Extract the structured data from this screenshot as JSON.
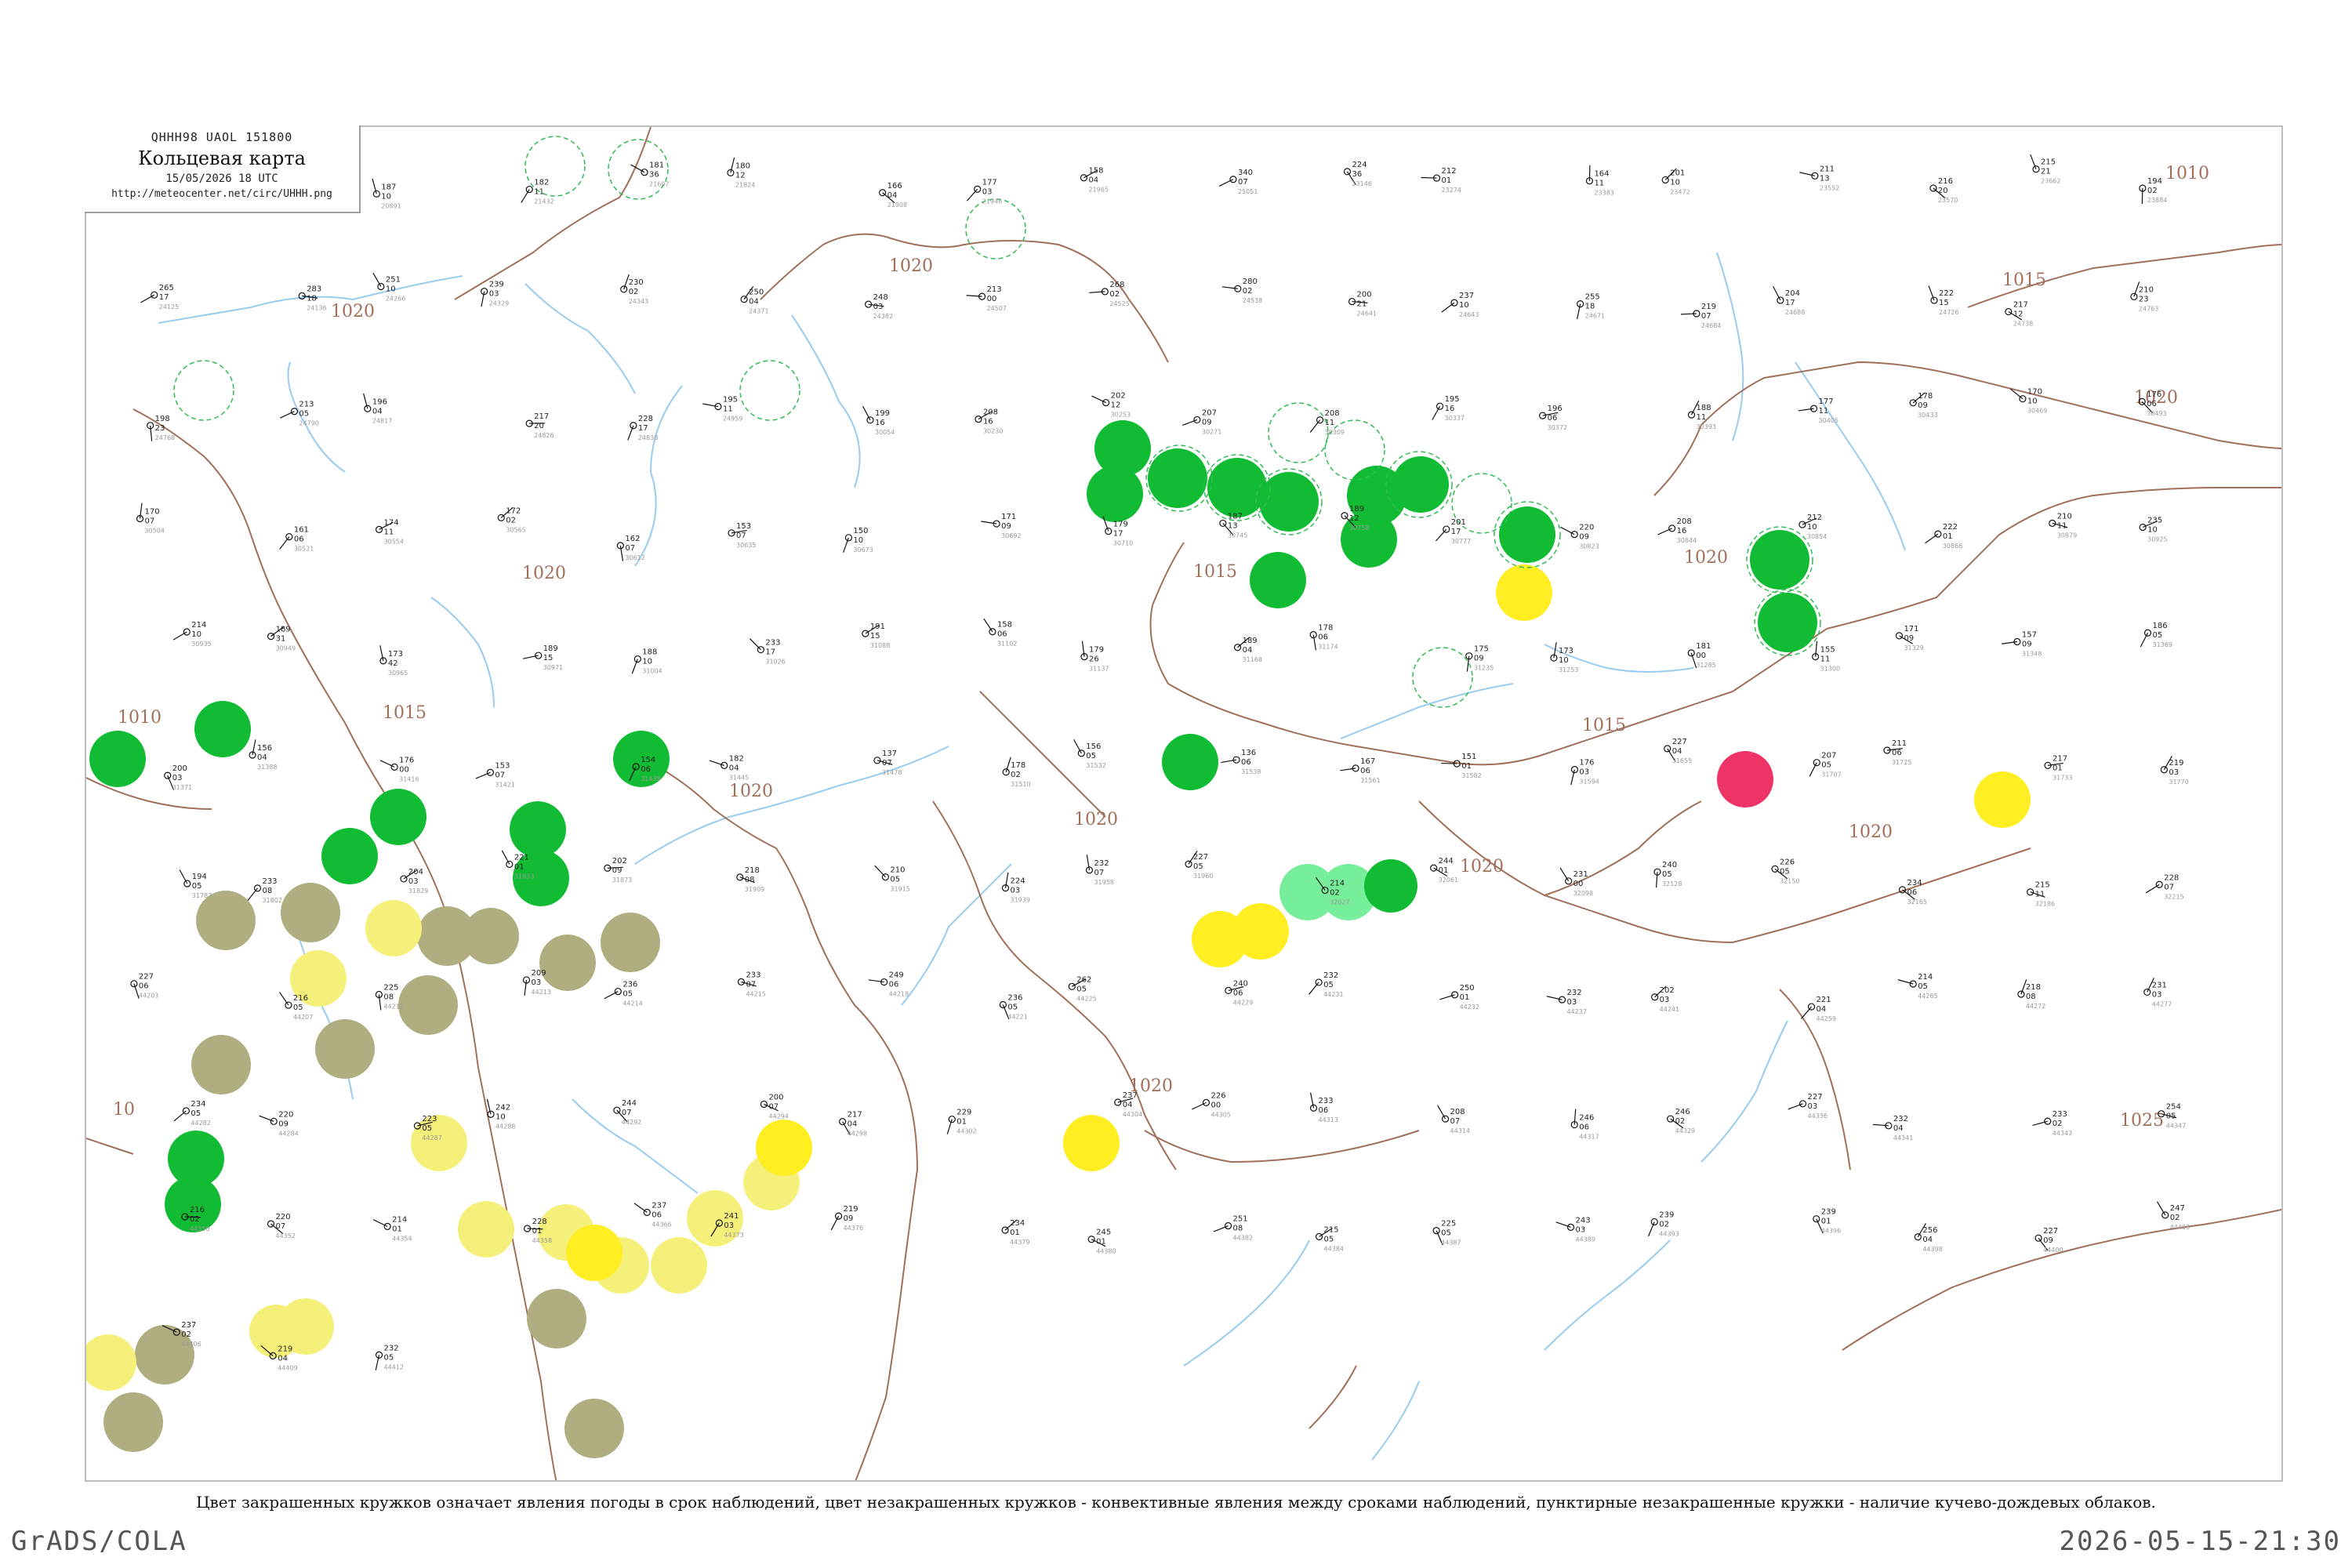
{
  "header": {
    "code": "QHHH98  UAOL  151800",
    "title": "Кольцевая карта",
    "datetime": "15/05/2026 18 UTC",
    "url": "http://meteocenter.net/circ/UHHH.png"
  },
  "caption": "Цвет закрашенных кружков означает явления погоды в срок наблюдений, цвет незакрашенных кружков - конвективные явления между сроками наблюдений, пунктирные незакрашенные кружки - наличие кучево-дождевых облаков.",
  "footer": {
    "left": "GrADS/COLA",
    "right": "2026-05-15-21:30"
  },
  "colors": {
    "rain": "#11bb33",
    "drizzle": "#77ee99",
    "haze": "#b0ad80",
    "dust": "#f5f07a",
    "fog": "#ffee22",
    "thunder": "#ee3366",
    "isobar": "#a0705a",
    "river": "#99ccee"
  },
  "isobar_labels": [
    "1010",
    "1015",
    "1020",
    "1020",
    "1020",
    "1020",
    "1015",
    "1015",
    "1020",
    "1020",
    "1015",
    "1020",
    "1020",
    "1025",
    "1010",
    "10",
    "1020",
    "1020"
  ],
  "stations": [
    {
      "t": "175",
      "p": "11",
      "id": "20744"
    },
    {
      "t": "149",
      "p": "03",
      "id": "20667"
    },
    {
      "t": "187",
      "p": "10",
      "id": "20891"
    },
    {
      "t": "182",
      "p": "11",
      "id": "21432"
    },
    {
      "t": "181",
      "p": "36",
      "id": "21607"
    },
    {
      "t": "180",
      "p": "12",
      "id": "21824"
    },
    {
      "t": "166",
      "p": "04",
      "id": "21908"
    },
    {
      "t": "177",
      "p": "03",
      "id": "21946"
    },
    {
      "t": "158",
      "p": "04",
      "id": "21965"
    },
    {
      "t": "340",
      "p": "07",
      "id": "25051"
    },
    {
      "t": "224",
      "p": "36",
      "id": "23146"
    },
    {
      "t": "212",
      "p": "01",
      "id": "23274"
    },
    {
      "t": "164",
      "p": "11",
      "id": "23383"
    },
    {
      "t": "201",
      "p": "10",
      "id": "23472"
    },
    {
      "t": "211",
      "p": "13",
      "id": "23552"
    },
    {
      "t": "216",
      "p": "20",
      "id": "23570"
    },
    {
      "t": "215",
      "p": "21",
      "id": "23662"
    },
    {
      "t": "194",
      "p": "02",
      "id": "23884"
    },
    {
      "t": "265",
      "p": "17",
      "id": "24125"
    },
    {
      "t": "283",
      "p": "18",
      "id": "24136"
    },
    {
      "t": "251",
      "p": "10",
      "id": "24266"
    },
    {
      "t": "239",
      "p": "03",
      "id": "24329"
    },
    {
      "t": "230",
      "p": "02",
      "id": "24343"
    },
    {
      "t": "250",
      "p": "04",
      "id": "24371"
    },
    {
      "t": "248",
      "p": "03",
      "id": "24382"
    },
    {
      "t": "213",
      "p": "00",
      "id": "24507"
    },
    {
      "t": "268",
      "p": "02",
      "id": "24525"
    },
    {
      "t": "280",
      "p": "02",
      "id": "24538"
    },
    {
      "t": "200",
      "p": "21",
      "id": "24641"
    },
    {
      "t": "237",
      "p": "10",
      "id": "24643"
    },
    {
      "t": "255",
      "p": "18",
      "id": "24671"
    },
    {
      "t": "219",
      "p": "07",
      "id": "24684"
    },
    {
      "t": "204",
      "p": "17",
      "id": "24688"
    },
    {
      "t": "222",
      "p": "15",
      "id": "24726"
    },
    {
      "t": "217",
      "p": "12",
      "id": "24738"
    },
    {
      "t": "210",
      "p": "23",
      "id": "24763"
    },
    {
      "t": "198",
      "p": "23",
      "id": "24768"
    },
    {
      "t": "213",
      "p": "05",
      "id": "24790"
    },
    {
      "t": "196",
      "p": "04",
      "id": "24817"
    },
    {
      "t": "217",
      "p": "20",
      "id": "24826"
    },
    {
      "t": "228",
      "p": "17",
      "id": "24838"
    },
    {
      "t": "195",
      "p": "11",
      "id": "24959"
    },
    {
      "t": "199",
      "p": "16",
      "id": "30054"
    },
    {
      "t": "208",
      "p": "16",
      "id": "30230"
    },
    {
      "t": "202",
      "p": "12",
      "id": "30253"
    },
    {
      "t": "207",
      "p": "09",
      "id": "30271"
    },
    {
      "t": "208",
      "p": "11",
      "id": "30309"
    },
    {
      "t": "195",
      "p": "16",
      "id": "30337"
    },
    {
      "t": "196",
      "p": "06",
      "id": "30372"
    },
    {
      "t": "188",
      "p": "11",
      "id": "30393"
    },
    {
      "t": "177",
      "p": "11",
      "id": "30405"
    },
    {
      "t": "178",
      "p": "09",
      "id": "30433"
    },
    {
      "t": "170",
      "p": "10",
      "id": "30469"
    },
    {
      "t": "176",
      "p": "06",
      "id": "30493"
    },
    {
      "t": "170",
      "p": "07",
      "id": "30504"
    },
    {
      "t": "161",
      "p": "06",
      "id": "30521"
    },
    {
      "t": "174",
      "p": "11",
      "id": "30554"
    },
    {
      "t": "172",
      "p": "02",
      "id": "30565"
    },
    {
      "t": "162",
      "p": "07",
      "id": "30612"
    },
    {
      "t": "153",
      "p": "07",
      "id": "30635"
    },
    {
      "t": "150",
      "p": "10",
      "id": "30673"
    },
    {
      "t": "171",
      "p": "09",
      "id": "30692"
    },
    {
      "t": "179",
      "p": "17",
      "id": "30710"
    },
    {
      "t": "187",
      "p": "13",
      "id": "30745"
    },
    {
      "t": "189",
      "p": "12",
      "id": "30758"
    },
    {
      "t": "201",
      "p": "17",
      "id": "30777"
    },
    {
      "t": "220",
      "p": "09",
      "id": "30823"
    },
    {
      "t": "208",
      "p": "16",
      "id": "30844"
    },
    {
      "t": "212",
      "p": "10",
      "id": "30854"
    },
    {
      "t": "222",
      "p": "01",
      "id": "30866"
    },
    {
      "t": "210",
      "p": "11",
      "id": "30879"
    },
    {
      "t": "235",
      "p": "10",
      "id": "30925"
    },
    {
      "t": "214",
      "p": "10",
      "id": "30935"
    },
    {
      "t": "189",
      "p": "31",
      "id": "30949"
    },
    {
      "t": "173",
      "p": "42",
      "id": "30965"
    },
    {
      "t": "189",
      "p": "15",
      "id": "30971"
    },
    {
      "t": "188",
      "p": "10",
      "id": "31004"
    },
    {
      "t": "233",
      "p": "17",
      "id": "31026"
    },
    {
      "t": "191",
      "p": "15",
      "id": "31088"
    },
    {
      "t": "158",
      "p": "06",
      "id": "31102"
    },
    {
      "t": "179",
      "p": "26",
      "id": "31137"
    },
    {
      "t": "189",
      "p": "04",
      "id": "31168"
    },
    {
      "t": "178",
      "p": "06",
      "id": "31174"
    },
    {
      "t": "175",
      "p": "09",
      "id": "31235"
    },
    {
      "t": "173",
      "p": "10",
      "id": "31253"
    },
    {
      "t": "181",
      "p": "00",
      "id": "31285"
    },
    {
      "t": "155",
      "p": "11",
      "id": "31300"
    },
    {
      "t": "171",
      "p": "09",
      "id": "31329"
    },
    {
      "t": "157",
      "p": "09",
      "id": "31348"
    },
    {
      "t": "186",
      "p": "05",
      "id": "31369"
    },
    {
      "t": "200",
      "p": "03",
      "id": "31371"
    },
    {
      "t": "156",
      "p": "04",
      "id": "31388"
    },
    {
      "t": "176",
      "p": "00",
      "id": "31416"
    },
    {
      "t": "153",
      "p": "07",
      "id": "31421"
    },
    {
      "t": "154",
      "p": "06",
      "id": "31439"
    },
    {
      "t": "182",
      "p": "04",
      "id": "31445"
    },
    {
      "t": "137",
      "p": "07",
      "id": "31478"
    },
    {
      "t": "178",
      "p": "02",
      "id": "31510"
    },
    {
      "t": "156",
      "p": "05",
      "id": "31532"
    },
    {
      "t": "136",
      "p": "06",
      "id": "31538"
    },
    {
      "t": "167",
      "p": "06",
      "id": "31561"
    },
    {
      "t": "151",
      "p": "01",
      "id": "31582"
    },
    {
      "t": "176",
      "p": "03",
      "id": "31594"
    },
    {
      "t": "227",
      "p": "04",
      "id": "31655"
    },
    {
      "t": "207",
      "p": "05",
      "id": "31707"
    },
    {
      "t": "211",
      "p": "06",
      "id": "31725"
    },
    {
      "t": "217",
      "p": "01",
      "id": "31733"
    },
    {
      "t": "219",
      "p": "03",
      "id": "31770"
    },
    {
      "t": "194",
      "p": "05",
      "id": "31787"
    },
    {
      "t": "233",
      "p": "08",
      "id": "31802"
    },
    {
      "t": "204",
      "p": "03",
      "id": "31829"
    },
    {
      "t": "221",
      "p": "01",
      "id": "31833"
    },
    {
      "t": "202",
      "p": "09",
      "id": "31873"
    },
    {
      "t": "218",
      "p": "08",
      "id": "31909"
    },
    {
      "t": "210",
      "p": "05",
      "id": "31915"
    },
    {
      "t": "224",
      "p": "03",
      "id": "31939"
    },
    {
      "t": "232",
      "p": "07",
      "id": "31958"
    },
    {
      "t": "227",
      "p": "05",
      "id": "31960"
    },
    {
      "t": "214",
      "p": "02",
      "id": "32027"
    },
    {
      "t": "244",
      "p": "01",
      "id": "32061"
    },
    {
      "t": "231",
      "p": "00",
      "id": "32098"
    },
    {
      "t": "240",
      "p": "05",
      "id": "32128"
    },
    {
      "t": "226",
      "p": "05",
      "id": "32150"
    },
    {
      "t": "234",
      "p": "06",
      "id": "32165"
    },
    {
      "t": "215",
      "p": "11",
      "id": "32186"
    },
    {
      "t": "228",
      "p": "07",
      "id": "32215"
    },
    {
      "t": "227",
      "p": "06",
      "id": "44203"
    },
    {
      "t": "216",
      "p": "05",
      "id": "44207"
    },
    {
      "t": "225",
      "p": "08",
      "id": "44212"
    },
    {
      "t": "209",
      "p": "03",
      "id": "44213"
    },
    {
      "t": "236",
      "p": "05",
      "id": "44214"
    },
    {
      "t": "233",
      "p": "07",
      "id": "44215"
    },
    {
      "t": "249",
      "p": "06",
      "id": "44218"
    },
    {
      "t": "236",
      "p": "05",
      "id": "44221"
    },
    {
      "t": "262",
      "p": "05",
      "id": "44225"
    },
    {
      "t": "240",
      "p": "06",
      "id": "44229"
    },
    {
      "t": "232",
      "p": "05",
      "id": "44231"
    },
    {
      "t": "250",
      "p": "01",
      "id": "44232"
    },
    {
      "t": "232",
      "p": "03",
      "id": "44237"
    },
    {
      "t": "202",
      "p": "03",
      "id": "44241"
    },
    {
      "t": "221",
      "p": "04",
      "id": "44259"
    },
    {
      "t": "214",
      "p": "05",
      "id": "44265"
    },
    {
      "t": "218",
      "p": "08",
      "id": "44272"
    },
    {
      "t": "231",
      "p": "03",
      "id": "44277"
    },
    {
      "t": "234",
      "p": "05",
      "id": "44282"
    },
    {
      "t": "220",
      "p": "09",
      "id": "44284"
    },
    {
      "t": "223",
      "p": "05",
      "id": "44287"
    },
    {
      "t": "242",
      "p": "10",
      "id": "44288"
    },
    {
      "t": "244",
      "p": "07",
      "id": "44292"
    },
    {
      "t": "200",
      "p": "07",
      "id": "44294"
    },
    {
      "t": "217",
      "p": "04",
      "id": "44298"
    },
    {
      "t": "229",
      "p": "01",
      "id": "44302"
    },
    {
      "t": "237",
      "p": "04",
      "id": "44304"
    },
    {
      "t": "226",
      "p": "00",
      "id": "44305"
    },
    {
      "t": "233",
      "p": "06",
      "id": "44313"
    },
    {
      "t": "208",
      "p": "07",
      "id": "44314"
    },
    {
      "t": "246",
      "p": "06",
      "id": "44317"
    },
    {
      "t": "246",
      "p": "02",
      "id": "44329"
    },
    {
      "t": "227",
      "p": "03",
      "id": "44336"
    },
    {
      "t": "232",
      "p": "04",
      "id": "44341"
    },
    {
      "t": "233",
      "p": "02",
      "id": "44343"
    },
    {
      "t": "254",
      "p": "05",
      "id": "44347"
    },
    {
      "t": "216",
      "p": "02",
      "id": "44350"
    },
    {
      "t": "220",
      "p": "07",
      "id": "44352"
    },
    {
      "t": "214",
      "p": "01",
      "id": "44354"
    },
    {
      "t": "228",
      "p": "01",
      "id": "44358"
    },
    {
      "t": "237",
      "p": "06",
      "id": "44366"
    },
    {
      "t": "241",
      "p": "03",
      "id": "44373"
    },
    {
      "t": "219",
      "p": "09",
      "id": "44376"
    },
    {
      "t": "234",
      "p": "01",
      "id": "44379"
    },
    {
      "t": "245",
      "p": "01",
      "id": "44380"
    },
    {
      "t": "251",
      "p": "08",
      "id": "44382"
    },
    {
      "t": "215",
      "p": "05",
      "id": "44384"
    },
    {
      "t": "225",
      "p": "05",
      "id": "44387"
    },
    {
      "t": "243",
      "p": "03",
      "id": "44389"
    },
    {
      "t": "239",
      "p": "02",
      "id": "44393"
    },
    {
      "t": "239",
      "p": "01",
      "id": "44396"
    },
    {
      "t": "256",
      "p": "04",
      "id": "44398"
    },
    {
      "t": "227",
      "p": "09",
      "id": "44400"
    },
    {
      "t": "247",
      "p": "02",
      "id": "44403"
    },
    {
      "t": "237",
      "p": "02",
      "id": "44406"
    },
    {
      "t": "219",
      "p": "04",
      "id": "44409"
    },
    {
      "t": "232",
      "p": "05",
      "id": "44412"
    }
  ]
}
